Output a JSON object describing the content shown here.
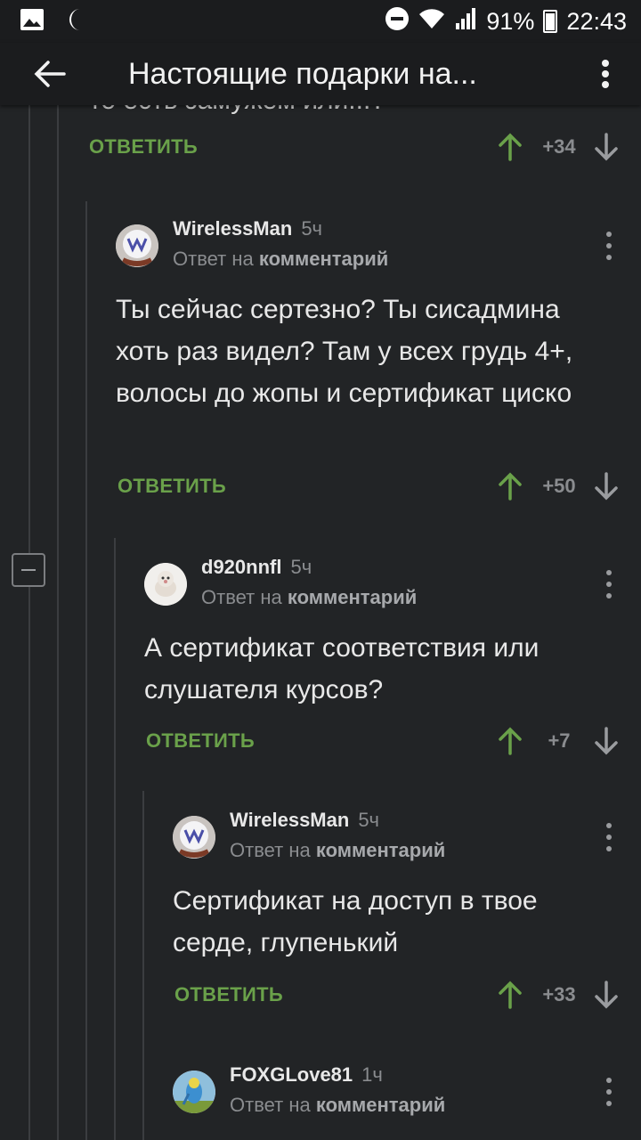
{
  "status_bar": {
    "battery": "91%",
    "time": "22:43"
  },
  "app_bar": {
    "title": "Настоящие подарки на..."
  },
  "colors": {
    "accent_green": "#6aa14a",
    "background": "#222426",
    "toolbar": "#1b1c1e"
  },
  "previous_comment": {
    "clipped_text": "то есть замужем или...?",
    "reply_label": "ОТВЕТИТЬ",
    "vote_count": "+34"
  },
  "comments": [
    {
      "author": "WirelessMan",
      "time": "5ч",
      "reply_prefix": "Ответ на",
      "reply_target": "комментарий",
      "text": "Ты сейчас сертезно? Ты сисадмина хоть раз видел? Там у всех грудь 4+, волосы до жопы и сертификат циско",
      "reply_label": "ОТВЕТИТЬ",
      "vote_count": "+50"
    },
    {
      "author": "d920nnfl",
      "time": "5ч",
      "reply_prefix": "Ответ на",
      "reply_target": "комментарий",
      "text": "А сертификат соответствия или слушателя курсов?",
      "reply_label": "ОТВЕТИТЬ",
      "vote_count": "+7"
    },
    {
      "author": "WirelessMan",
      "time": "5ч",
      "reply_prefix": "Ответ на",
      "reply_target": "комментарий",
      "text": "Сертификат на доступ в твое серде, глупенький",
      "reply_label": "ОТВЕТИТЬ",
      "vote_count": "+33"
    },
    {
      "author": "FOXGLove81",
      "time": "1ч",
      "reply_prefix": "Ответ на",
      "reply_target": "комментарий"
    }
  ]
}
